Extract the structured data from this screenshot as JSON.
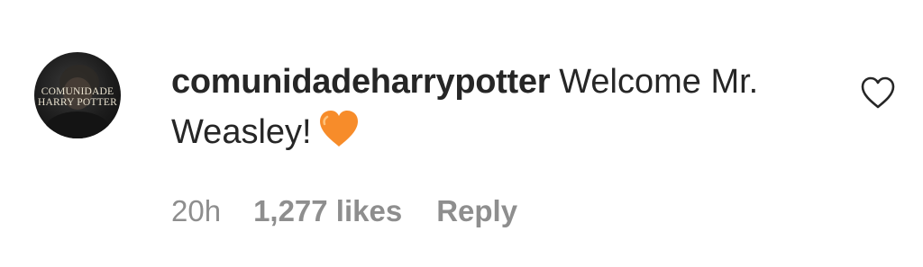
{
  "comment": {
    "avatar": {
      "logo_line1": "COMUNIDADE",
      "logo_line2": "HARRY POTTER"
    },
    "username": "comunidadeharrypotter",
    "text": "Welcome Mr. Weasley!",
    "emoji": "orange-heart",
    "time": "20h",
    "likes": "1,277 likes",
    "reply_label": "Reply",
    "like_icon": "heart-outline-icon"
  },
  "colors": {
    "text": "#262626",
    "secondary_text": "#8e8e8e",
    "heart_orange": "#f78c2a"
  }
}
